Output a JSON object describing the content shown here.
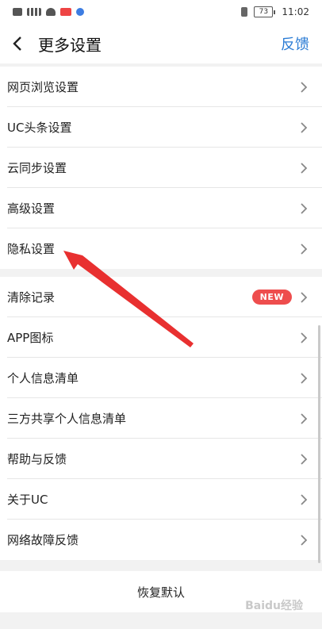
{
  "status": {
    "time": "11:02",
    "battery": "73"
  },
  "header": {
    "title": "更多设置",
    "feedback": "反馈"
  },
  "group1": [
    {
      "label": "网页浏览设置"
    },
    {
      "label": "UC头条设置"
    },
    {
      "label": "云同步设置"
    },
    {
      "label": "高级设置"
    },
    {
      "label": "隐私设置"
    }
  ],
  "group2": [
    {
      "label": "清除记录",
      "badge": "NEW"
    },
    {
      "label": "APP图标"
    },
    {
      "label": "个人信息清单"
    },
    {
      "label": "三方共享个人信息清单"
    },
    {
      "label": "帮助与反馈"
    },
    {
      "label": "关于UC"
    },
    {
      "label": "网络故障反馈"
    }
  ],
  "restore": {
    "label": "恢复默认"
  },
  "watermark": {
    "text": "Baidu经验"
  },
  "colors": {
    "accent": "#2a7bd4",
    "badge": "#ee4d4d",
    "arrow": "#e83030"
  }
}
